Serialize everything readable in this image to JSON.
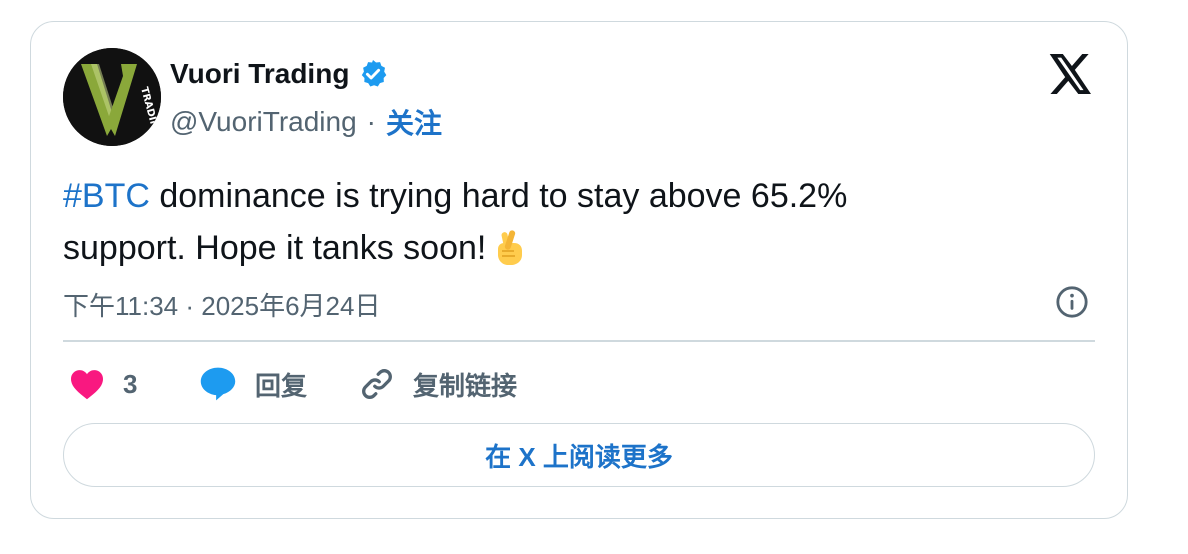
{
  "author": {
    "display_name": "Vuori Trading",
    "handle": "@VuoriTrading",
    "separator": "·",
    "follow_label": "关注",
    "avatar_text": "TRADING"
  },
  "tweet": {
    "hashtag": "#BTC",
    "text_line1": " dominance is trying hard to stay above 65.2%",
    "text_line2": "support. Hope it tanks soon!",
    "emoji": "crossed-fingers-icon",
    "timestamp": "下午11:34 · 2025年6月24日"
  },
  "actions": {
    "like_count": "3",
    "reply_label": "回复",
    "copy_link_label": "复制链接"
  },
  "read_more_label": "在 X 上阅读更多",
  "colors": {
    "accent": "#1d73c9",
    "like": "#f91880",
    "reply": "#1d9bf0",
    "muted": "#536471",
    "border": "#cfd9de",
    "verified": "#1d9bf0",
    "avatar_bg": "#111111",
    "avatar_logo": "#8aa83a"
  }
}
